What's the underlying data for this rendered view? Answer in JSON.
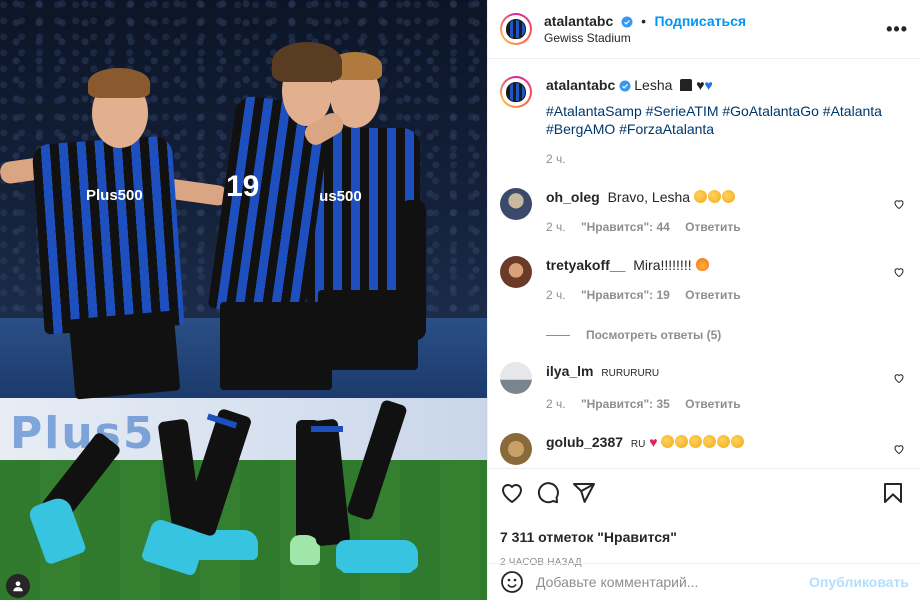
{
  "header": {
    "username": "atalantabc",
    "follow_label": "Подписаться",
    "location": "Gewiss Stadium",
    "separator": "•",
    "more_label": "•••"
  },
  "photo": {
    "sponsor": "Plus500",
    "sponsor_text_back": "Plus500",
    "number": "19",
    "board_text": "Plus5"
  },
  "caption": {
    "username": "atalantabc",
    "text": "Lesha",
    "hashtags": "#AtalantaSamp #SerieATIM #GoAtalantaGo #Atalanta #BergAMO #ForzaAtalanta",
    "time": "2 ч."
  },
  "comments": [
    {
      "username": "oh_oleg",
      "text": "Bravo, Lesha",
      "time": "2 ч.",
      "likes": "\"Нравится\": 44",
      "reply": "Ответить",
      "emoji": "clap3"
    },
    {
      "username": "tretyakoff__",
      "text": "Mira!!!!!!!!",
      "time": "2 ч.",
      "likes": "\"Нравится\": 19",
      "reply": "Ответить",
      "emoji": "fire"
    },
    {
      "username": "ilya_lm",
      "text": "RURURURU",
      "time": "2 ч.",
      "likes": "\"Нравится\": 35",
      "reply": "Ответить",
      "emoji": ""
    },
    {
      "username": "golub_2387",
      "text": "RU",
      "time": "",
      "likes": "",
      "reply": "",
      "emoji": "heart-clap"
    }
  ],
  "view_replies": "Посмотреть ответы (5)",
  "likes_text": "7 311 отметок \"Нравится\"",
  "posted_ago": "2 ЧАСОВ НАЗАД",
  "add_comment": {
    "placeholder": "Добавьте комментарий...",
    "publish_label": "Опубликовать"
  },
  "colors": {
    "link_blue": "#0095f6",
    "hashtag": "#00376b",
    "muted": "#8e8e8e",
    "publish_disabled": "#b2dffc"
  },
  "icons": [
    "heart-icon",
    "comment-icon",
    "share-icon",
    "bookmark-icon",
    "emoji-icon",
    "more-icon",
    "verified-icon",
    "user-tag-icon"
  ]
}
